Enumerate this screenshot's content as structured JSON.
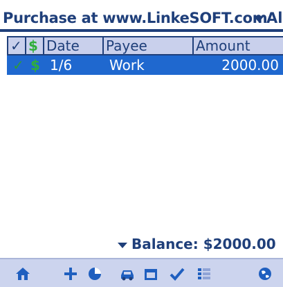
{
  "titlebar": {
    "title": "Purchase at www.LinkeSOFT.com",
    "filter_label": "Al"
  },
  "table": {
    "headers": {
      "check": "✓",
      "dollar": "$",
      "date": "Date",
      "payee": "Payee",
      "amount": "Amount"
    },
    "rows": [
      {
        "check": "✓",
        "dollar": "$",
        "date": "1/6",
        "payee": "Work",
        "amount": "2000.00"
      }
    ]
  },
  "balance": {
    "label": "Balance: $2000.00"
  },
  "toolbar": {
    "icons": [
      "home-icon",
      "add-icon",
      "chart-icon",
      "car-icon",
      "calendar-icon",
      "check-icon",
      "list-icon",
      "globe-icon"
    ]
  },
  "colors": {
    "accent": "#1f3f7a",
    "selection": "#1f68cf",
    "header_bg": "#c9d0ec",
    "toolbar_bg": "#ccd4ee",
    "green": "#2d9a3a"
  }
}
